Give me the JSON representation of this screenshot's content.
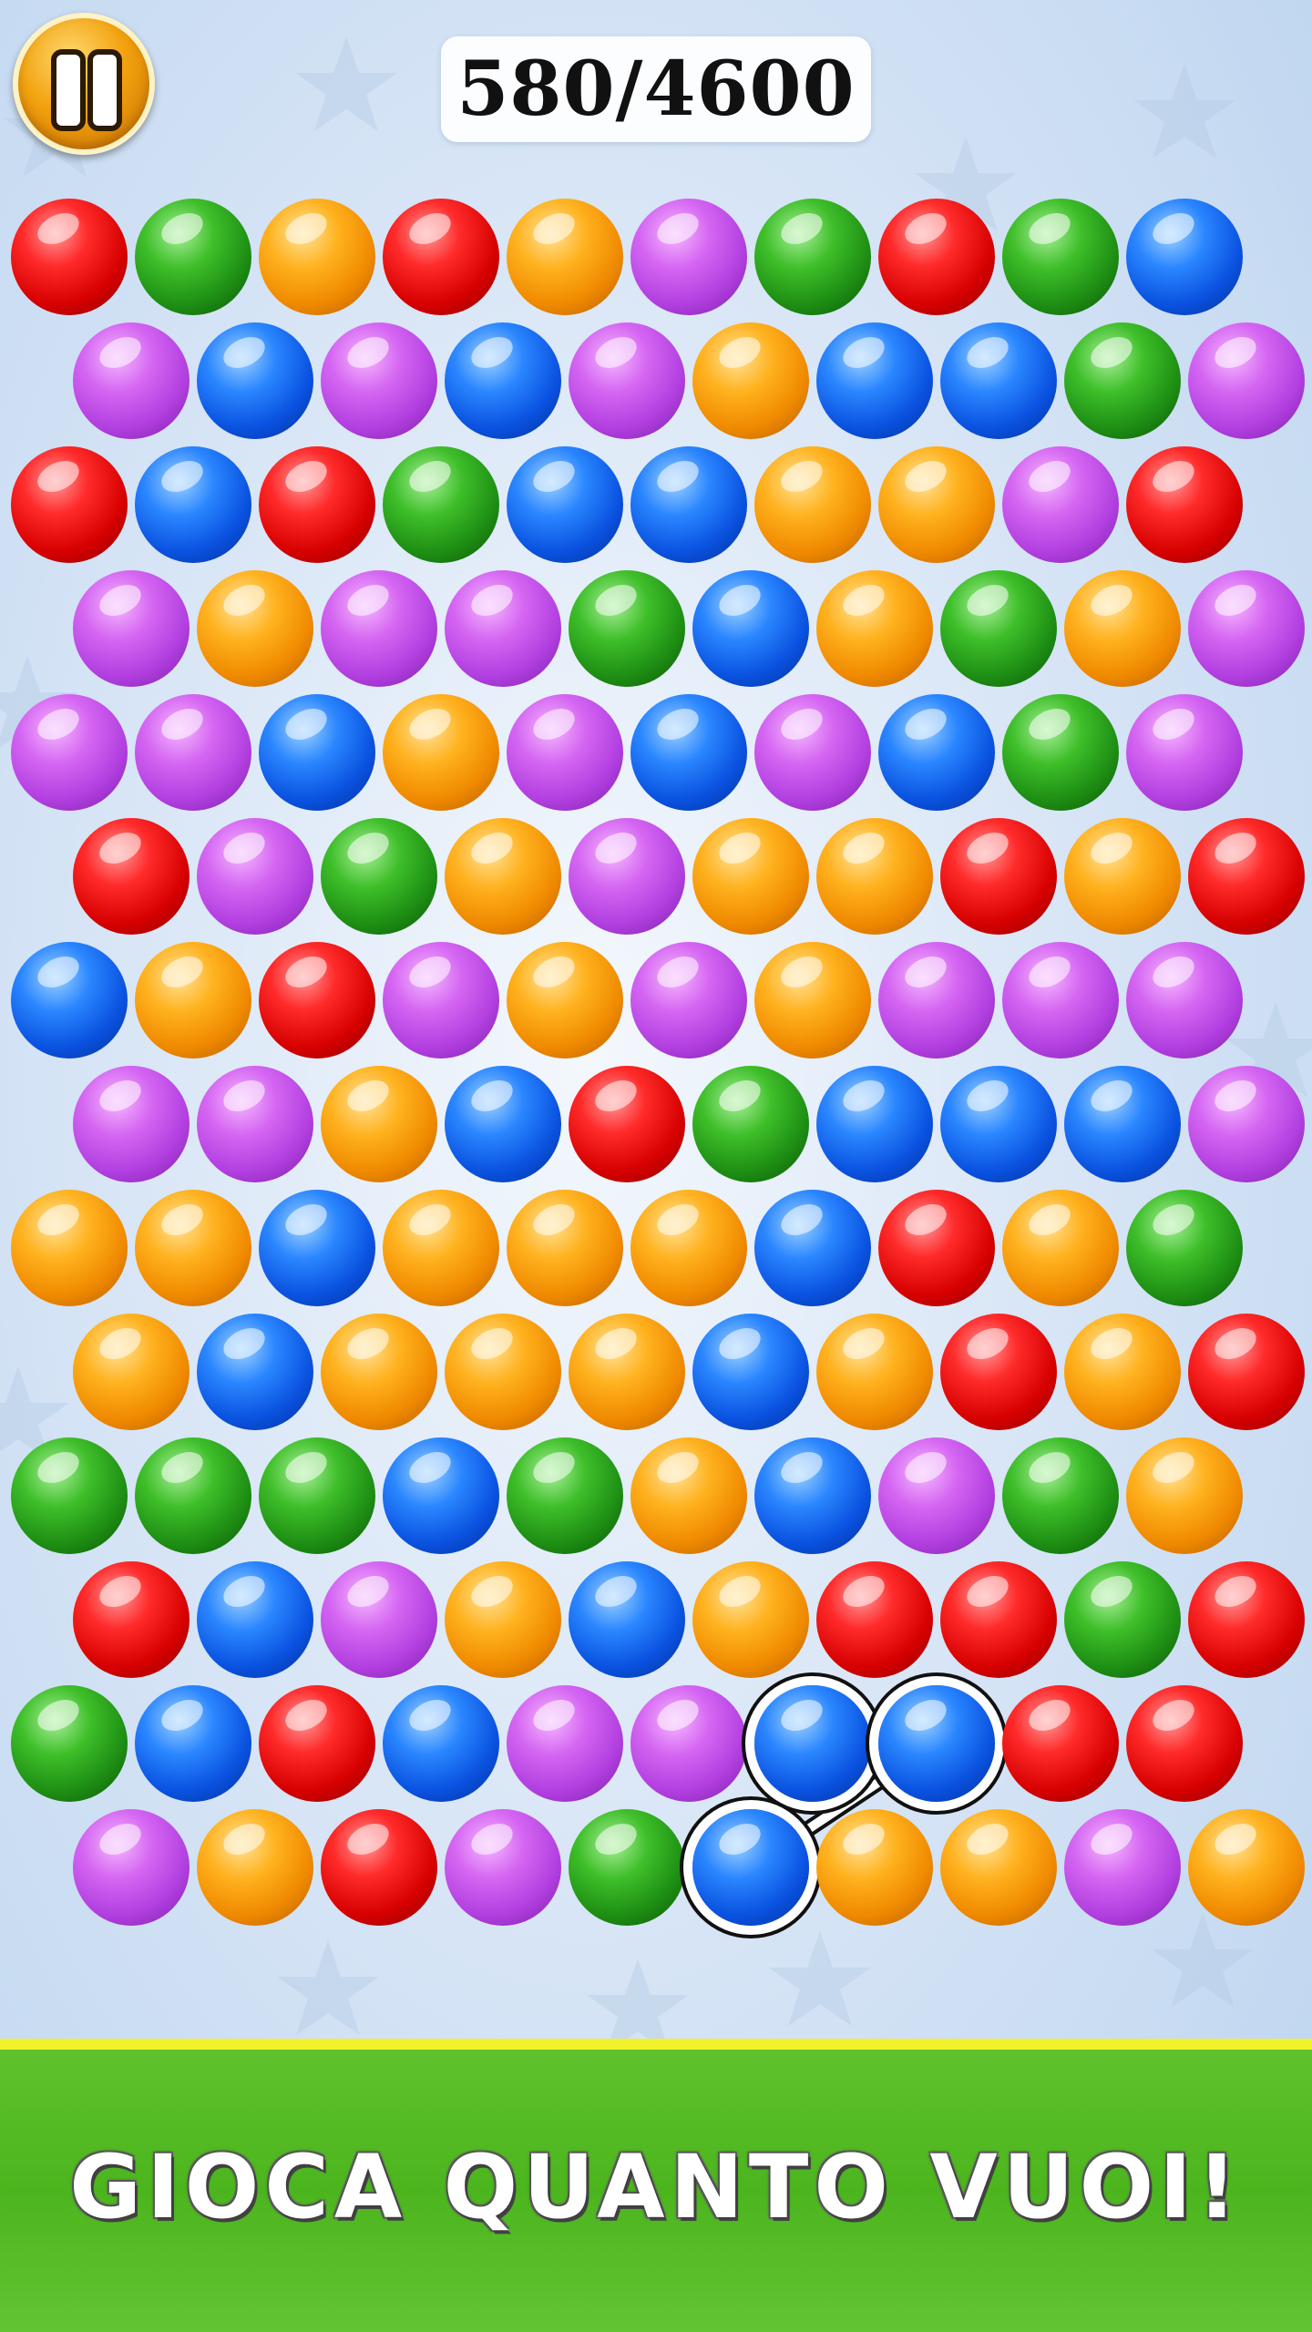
{
  "top_bar": {
    "pause_icon": "pause-icon",
    "score": "580/4600"
  },
  "board": {
    "rows": [
      [
        "red",
        "green",
        "orange",
        "red",
        "orange",
        "purple",
        "green",
        "red",
        "green",
        "blue"
      ],
      [
        "purple",
        "blue",
        "purple",
        "blue",
        "purple",
        "orange",
        "blue",
        "blue",
        "green",
        "purple"
      ],
      [
        "red",
        "blue",
        "red",
        "green",
        "blue",
        "blue",
        "orange",
        "orange",
        "purple",
        "red"
      ],
      [
        "purple",
        "orange",
        "purple",
        "purple",
        "green",
        "blue",
        "orange",
        "green",
        "orange",
        "purple"
      ],
      [
        "purple",
        "purple",
        "blue",
        "orange",
        "purple",
        "blue",
        "purple",
        "blue",
        "green",
        "purple"
      ],
      [
        "red",
        "purple",
        "green",
        "orange",
        "purple",
        "orange",
        "orange",
        "red",
        "orange",
        "red"
      ],
      [
        "blue",
        "orange",
        "red",
        "purple",
        "orange",
        "purple",
        "orange",
        "purple",
        "purple",
        "purple"
      ],
      [
        "purple",
        "purple",
        "orange",
        "blue",
        "red",
        "green",
        "blue",
        "blue",
        "blue",
        "purple"
      ],
      [
        "orange",
        "orange",
        "blue",
        "orange",
        "orange",
        "orange",
        "blue",
        "red",
        "orange",
        "green"
      ],
      [
        "orange",
        "blue",
        "orange",
        "orange",
        "orange",
        "blue",
        "orange",
        "red",
        "orange",
        "red"
      ],
      [
        "green",
        "green",
        "green",
        "blue",
        "green",
        "orange",
        "blue",
        "purple",
        "green",
        "orange"
      ],
      [
        "red",
        "blue",
        "purple",
        "orange",
        "blue",
        "orange",
        "red",
        "red",
        "green",
        "red"
      ],
      [
        "green",
        "blue",
        "red",
        "blue",
        "purple",
        "purple",
        "blue",
        "blue",
        "red",
        "red"
      ],
      [
        "purple",
        "orange",
        "red",
        "purple",
        "green",
        "blue",
        "orange",
        "orange",
        "purple",
        "orange"
      ]
    ],
    "selected": [
      [
        12,
        6
      ],
      [
        12,
        7
      ],
      [
        13,
        5
      ]
    ],
    "colors": {
      "red": "#e00000",
      "green": "#2aa51c",
      "orange": "#ffa010",
      "purple": "#c24fe8",
      "blue": "#1266f0"
    }
  },
  "banner": {
    "text": "GIOCA QUANTO VUOI!",
    "stripe_color": "#f2f22a",
    "background_color": "#55bb22"
  }
}
